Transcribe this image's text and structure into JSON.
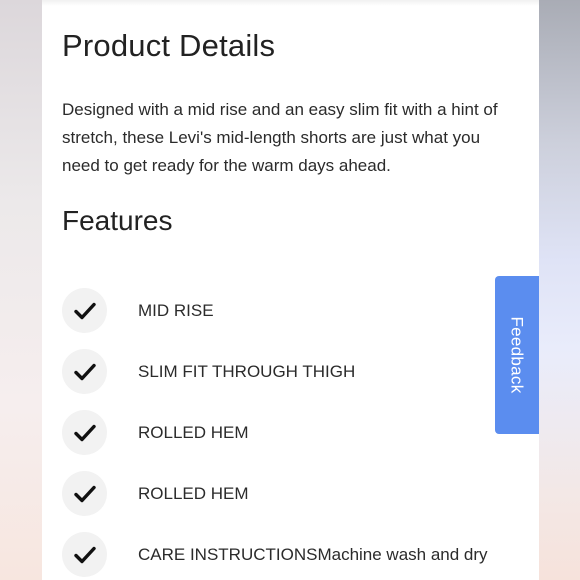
{
  "product": {
    "title": "Product Details",
    "description": "Designed with a mid rise and an easy slim fit with a hint of stretch, these Levi's mid-length shorts are just what you need to get ready for the warm days ahead."
  },
  "features": {
    "title": "Features",
    "items": [
      {
        "label": "MID RISE",
        "icon": "check-icon"
      },
      {
        "label": "SLIM FIT THROUGH THIGH",
        "icon": "check-icon"
      },
      {
        "label": "ROLLED HEM",
        "icon": "check-icon"
      },
      {
        "label": "ROLLED HEM",
        "icon": "check-icon"
      },
      {
        "label": "CARE INSTRUCTIONSMachine wash and dry",
        "icon": "check-icon"
      }
    ]
  },
  "feedback": {
    "label": "Feedback",
    "color": "#5b8def"
  }
}
